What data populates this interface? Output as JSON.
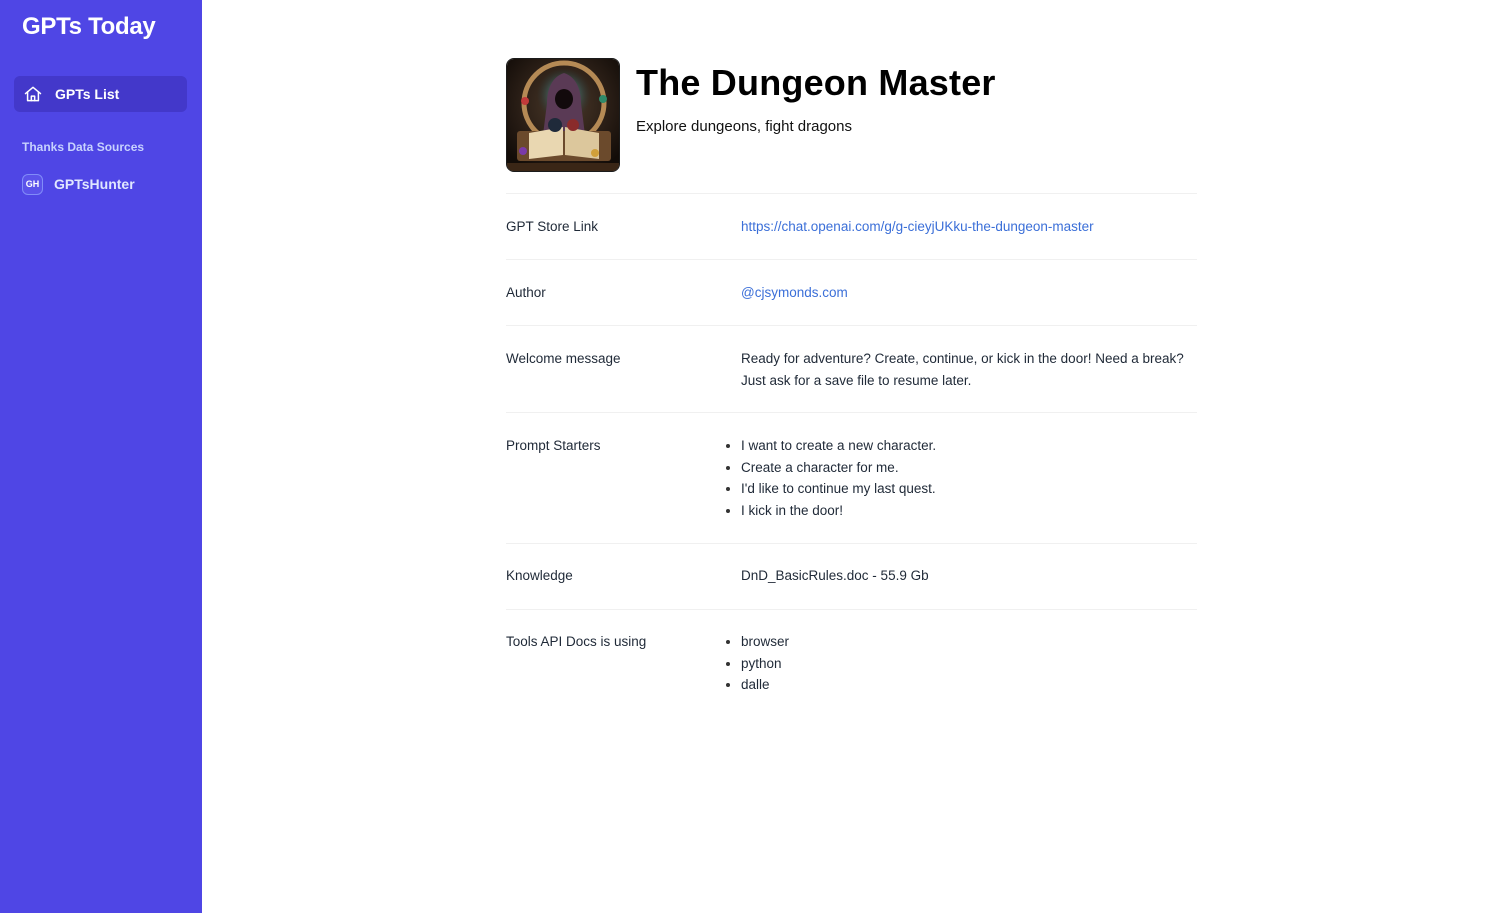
{
  "sidebar": {
    "brand": "GPTs Today",
    "nav": [
      {
        "label": "GPTs List",
        "icon": "home-icon"
      }
    ],
    "section_label": "Thanks Data Sources",
    "sources": [
      {
        "badge": "GH",
        "label": "GPTsHunter"
      }
    ]
  },
  "gpt": {
    "title": "The Dungeon Master",
    "description": "Explore dungeons, fight dragons"
  },
  "details": {
    "store_link": {
      "label": "GPT Store Link",
      "value": "https://chat.openai.com/g/g-cieyjUKku-the-dungeon-master"
    },
    "author": {
      "label": "Author",
      "value": "@cjsymonds.com"
    },
    "welcome": {
      "label": "Welcome message",
      "value": "Ready for adventure? Create, continue, or kick in the door! Need a break? Just ask for a save file to resume later."
    },
    "prompt_starters": {
      "label": "Prompt Starters",
      "items": [
        "I want to create a new character.",
        "Create a character for me.",
        "I'd like to continue my last quest.",
        "I kick in the door!"
      ]
    },
    "knowledge": {
      "label": "Knowledge",
      "value": "DnD_BasicRules.doc - 55.9 Gb"
    },
    "tools": {
      "label": "Tools API Docs is using",
      "items": [
        "browser",
        "python",
        "dalle"
      ]
    }
  },
  "colors": {
    "sidebar": "#4f46e5",
    "active_nav": "#4338ca",
    "link": "#3b6fd8"
  }
}
